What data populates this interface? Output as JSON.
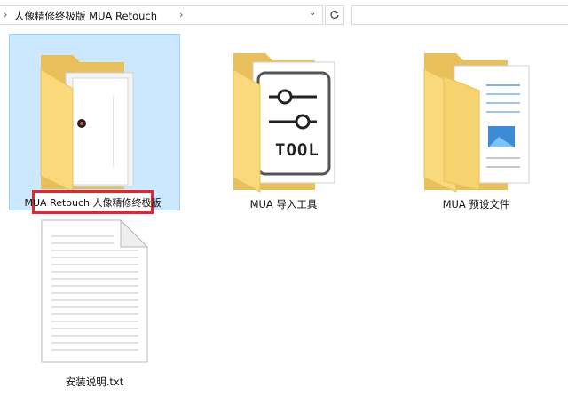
{
  "address_bar": {
    "path": "人像精修终极版 MUA Retouch",
    "search_placeholder": ""
  },
  "icons": {
    "breadcrumb_chevron": "chevron-right-icon",
    "dropdown": "chevron-down-icon",
    "refresh": "refresh-icon"
  },
  "items": [
    {
      "name": "MUA Retouch 人像精修终极版",
      "type": "folder",
      "selected": true
    },
    {
      "name": "MUA 导入工具",
      "type": "folder",
      "badge_text": "TOOL"
    },
    {
      "name": "MUA 预设文件",
      "type": "folder"
    },
    {
      "name": "安装说明.txt",
      "type": "text-file"
    }
  ],
  "colors": {
    "selection_fill": "#cce8ff",
    "selection_border": "#99d1ff",
    "highlight_box": "#e0282e",
    "folder_yellow": "#f8d775"
  }
}
